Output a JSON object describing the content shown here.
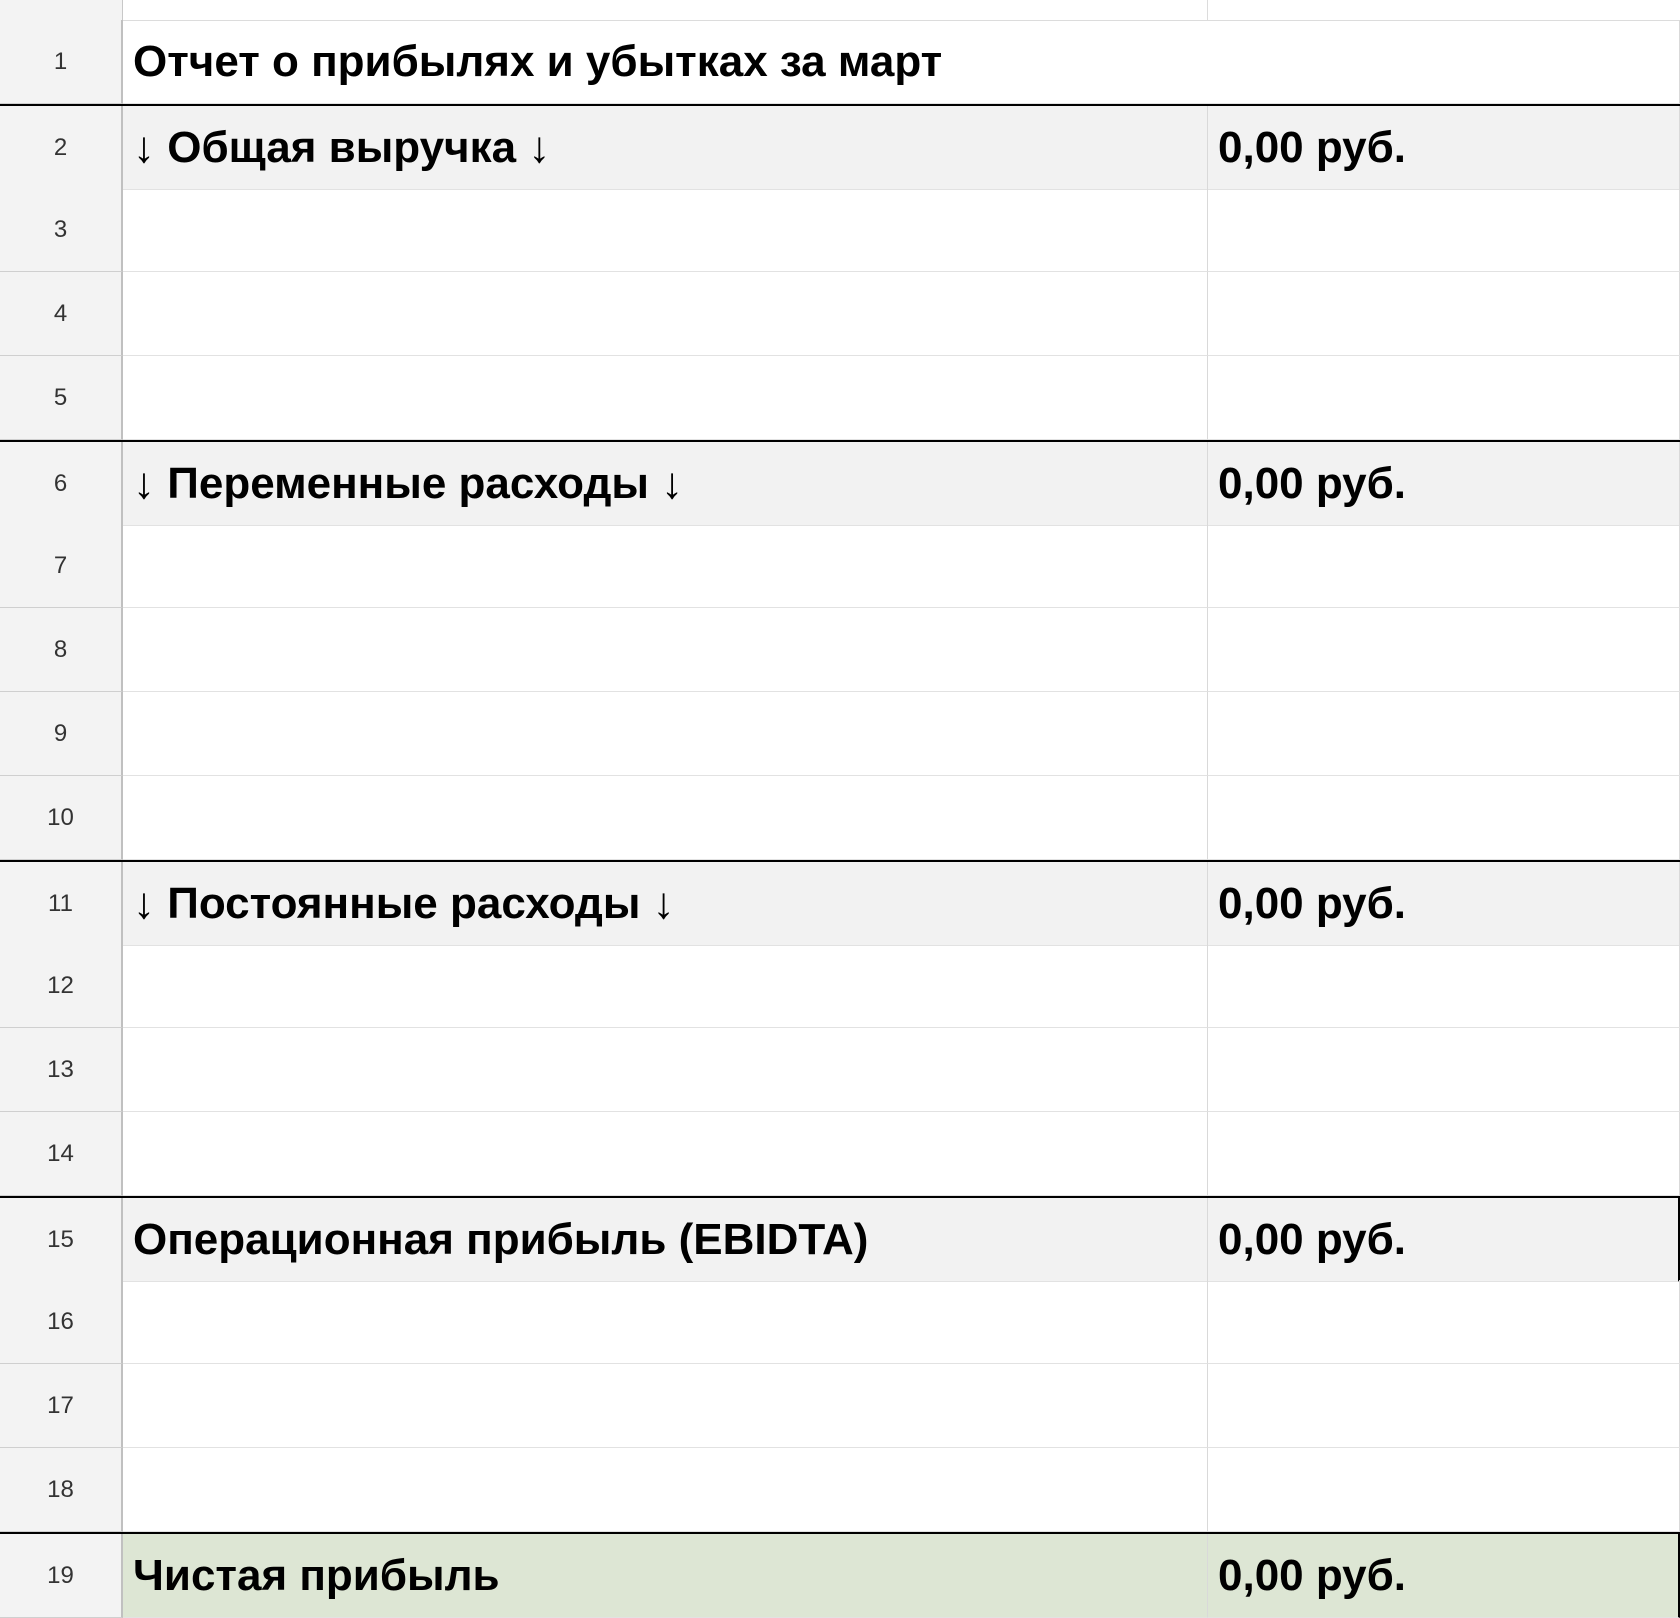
{
  "sheet": {
    "rows": [
      {
        "num": "1",
        "a": "Отчет о прибылях и убытках за март",
        "b": "",
        "style": "title"
      },
      {
        "num": "2",
        "a": "↓ Общая выручка ↓",
        "b": "0,00 руб.",
        "style": "section"
      },
      {
        "num": "3",
        "a": "",
        "b": "",
        "style": "plain"
      },
      {
        "num": "4",
        "a": "",
        "b": "",
        "style": "plain"
      },
      {
        "num": "5",
        "a": "",
        "b": "",
        "style": "plain"
      },
      {
        "num": "6",
        "a": "↓ Переменные расходы ↓",
        "b": "0,00 руб.",
        "style": "section"
      },
      {
        "num": "7",
        "a": "",
        "b": "",
        "style": "plain"
      },
      {
        "num": "8",
        "a": "",
        "b": "",
        "style": "plain"
      },
      {
        "num": "9",
        "a": "",
        "b": "",
        "style": "plain"
      },
      {
        "num": "10",
        "a": "",
        "b": "",
        "style": "plain"
      },
      {
        "num": "11",
        "a": "↓ Постоянные расходы ↓",
        "b": "0,00 руб.",
        "style": "section"
      },
      {
        "num": "12",
        "a": "",
        "b": "",
        "style": "plain"
      },
      {
        "num": "13",
        "a": "",
        "b": "",
        "style": "plain"
      },
      {
        "num": "14",
        "a": "",
        "b": "",
        "style": "plain"
      },
      {
        "num": "15",
        "a": "Операционная прибыль (EBIDTA)",
        "b": "0,00 руб.",
        "style": "boxed"
      },
      {
        "num": "16",
        "a": "",
        "b": "",
        "style": "plain"
      },
      {
        "num": "17",
        "a": "",
        "b": "",
        "style": "plain"
      },
      {
        "num": "18",
        "a": "",
        "b": "",
        "style": "plain"
      },
      {
        "num": "19",
        "a": "Чистая прибыль",
        "b": "0,00 руб.",
        "style": "total"
      }
    ]
  },
  "colors": {
    "header_bg": "#f3f3f3",
    "section_bg": "#f2f2f2",
    "total_bg": "#dde6d4",
    "border_dark": "#000000",
    "gridline": "#e2e2e2"
  }
}
